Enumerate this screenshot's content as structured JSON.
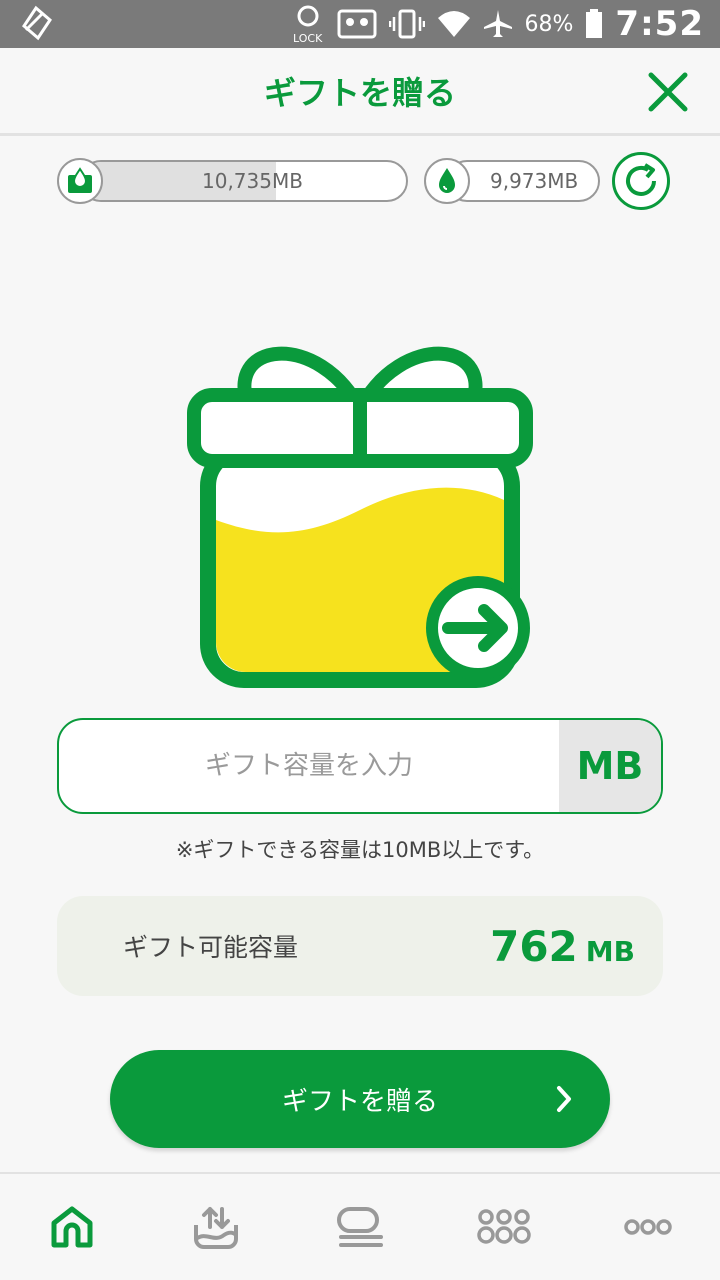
{
  "statusbar": {
    "battery_percent": "68%",
    "time": "7:52",
    "lock_label": "LOCK"
  },
  "header": {
    "title": "ギフトを贈る"
  },
  "capacity": {
    "primary_value": "10,735MB",
    "primary_fill_ratio": 0.6,
    "secondary_value": "9,973MB"
  },
  "form": {
    "placeholder": "ギフト容量を入力",
    "value": "",
    "unit": "MB",
    "note": "※ギフトできる容量は10MB以上です。"
  },
  "available": {
    "label": "ギフト可能容量",
    "amount": "762",
    "unit": "MB"
  },
  "submit": {
    "label": "ギフトを贈る"
  },
  "colors": {
    "accent": "#0a9a3c",
    "gift_fill": "#f6e21e"
  },
  "nav": {
    "items": [
      {
        "icon": "home-icon",
        "active": true
      },
      {
        "icon": "data-tray-icon",
        "active": false
      },
      {
        "icon": "stack-icon",
        "active": false
      },
      {
        "icon": "dots-grid-icon",
        "active": false
      },
      {
        "icon": "more-icon",
        "active": false
      }
    ]
  }
}
